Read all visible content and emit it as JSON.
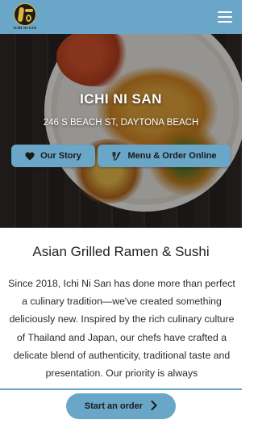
{
  "header": {
    "logo_caption": "ICHI NI SAN",
    "menu_icon": "hamburger-menu-icon"
  },
  "hero": {
    "title": "ICHI NI SAN",
    "address": "246 S BEACH ST, DAYTONA BEACH",
    "buttons": [
      {
        "label": "Our Story",
        "icon": "heart-icon"
      },
      {
        "label": "Menu & Order Online",
        "icon": "utensils-icon"
      }
    ]
  },
  "about": {
    "headline": "Asian Grilled Ramen & Sushi",
    "text": "Since 2018, Ichi Ni San has done more than perfect a culinary tradition—we've created something deliciously new. Inspired by the rich culinary culture of Thailand and Japan, our chefs have crafted a delicate blend of authenticity, traditional taste and presentation. Our priority is always"
  },
  "footer": {
    "order_label": "Start an order",
    "order_icon": "chevron-right-icon"
  },
  "colors": {
    "accent": "#6aa6c7",
    "logo_gold": "#e0b43a"
  }
}
